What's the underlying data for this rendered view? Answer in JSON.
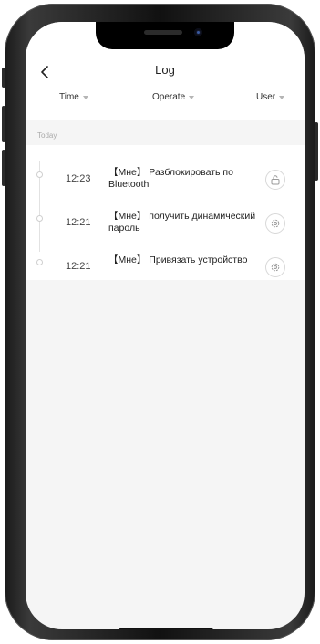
{
  "header": {
    "title": "Log",
    "back_icon": "chevron-left-icon"
  },
  "filters": [
    {
      "label": "Time"
    },
    {
      "label": "Operate"
    },
    {
      "label": "User"
    }
  ],
  "section": {
    "label": "Today"
  },
  "entries": [
    {
      "time": "12:23",
      "text": "【Мне】 Разблокировать по Bluetooth",
      "icon": "unlock-icon"
    },
    {
      "time": "12:21",
      "text": "【Мне】 получить динамический пароль",
      "icon": "settings-icon"
    },
    {
      "time": "12:21",
      "text": "【Мне】 Привязать устройство",
      "icon": "settings-icon"
    }
  ],
  "colors": {
    "background": "#f5f5f5",
    "card": "#ffffff",
    "text": "#222222",
    "muted": "#aaaaaa"
  }
}
